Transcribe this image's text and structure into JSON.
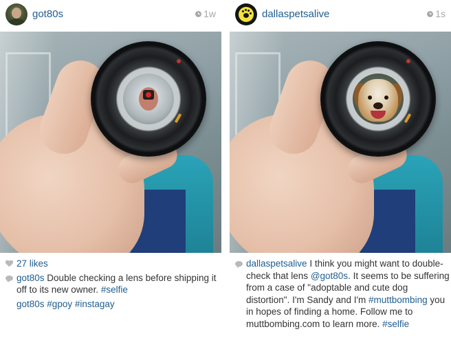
{
  "posts": [
    {
      "username": "got80s",
      "time": "1w",
      "likes": "27 likes",
      "caption": {
        "author": "got80s",
        "text": " Double checking a lens before shipping it off to its new owner. ",
        "hashtag": "#selfie"
      },
      "comment": {
        "author": "got80s",
        "tags": [
          " #gpoy",
          " #instagay"
        ]
      }
    },
    {
      "username": "dallaspetsalive",
      "time": "1s",
      "caption": {
        "author": "dallaspetsalive",
        "text1": " I think you might want to double-check that lens ",
        "mention": "@got80s",
        "text2": ". It seems to be suffering from a case of \"adoptable and cute dog distortion\". I'm Sandy and I'm ",
        "hashtag1": "#muttbombing",
        "text3": " you in hopes of finding a home. Follow me to muttbombing.com to learn more. ",
        "hashtag2": "#selfie"
      }
    }
  ],
  "colors": {
    "link": "#1f5d8f",
    "text": "#333333",
    "muted": "#a8a8a8",
    "logo_yellow": "#f4e23a"
  },
  "icons": [
    "clock-icon",
    "heart-icon",
    "comment-bubble-icon",
    "paw-icon"
  ]
}
